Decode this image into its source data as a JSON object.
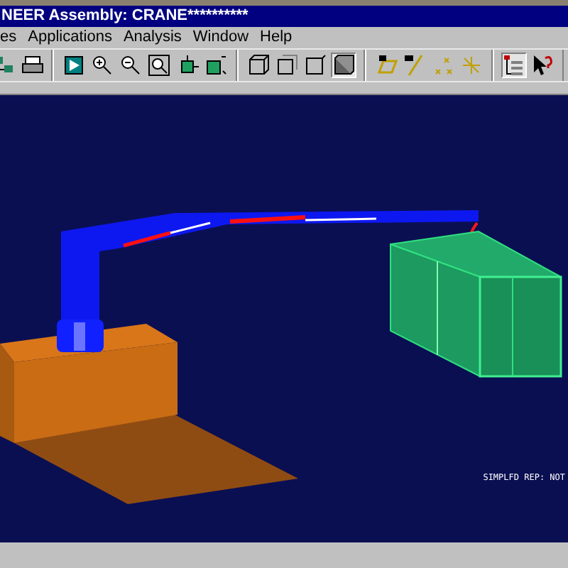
{
  "window": {
    "title": "NEER Assembly: CRANE**********"
  },
  "menu": [
    {
      "label": "es"
    },
    {
      "label": "Applications"
    },
    {
      "label": "Analysis"
    },
    {
      "label": "Window"
    },
    {
      "label": "Help"
    }
  ],
  "toolbar": [
    {
      "buttons": [
        {
          "pressed": false
        },
        {
          "pressed": false
        }
      ]
    },
    {
      "buttons": [
        {
          "pressed": false
        },
        {
          "pressed": false
        },
        {
          "pressed": false
        },
        {
          "pressed": false
        },
        {
          "pressed": false
        },
        {
          "pressed": false
        }
      ]
    },
    {
      "buttons": [
        {
          "pressed": false
        },
        {
          "pressed": false
        },
        {
          "pressed": false
        },
        {
          "pressed": true
        }
      ]
    },
    {
      "buttons": [
        {
          "pressed": false
        },
        {
          "pressed": false
        },
        {
          "pressed": false
        },
        {
          "pressed": false
        }
      ]
    },
    {
      "buttons": [
        {
          "pressed": true
        },
        {
          "pressed": false
        }
      ]
    }
  ],
  "viewport": {
    "status_text": "SIMPLFD REP: NOT"
  }
}
